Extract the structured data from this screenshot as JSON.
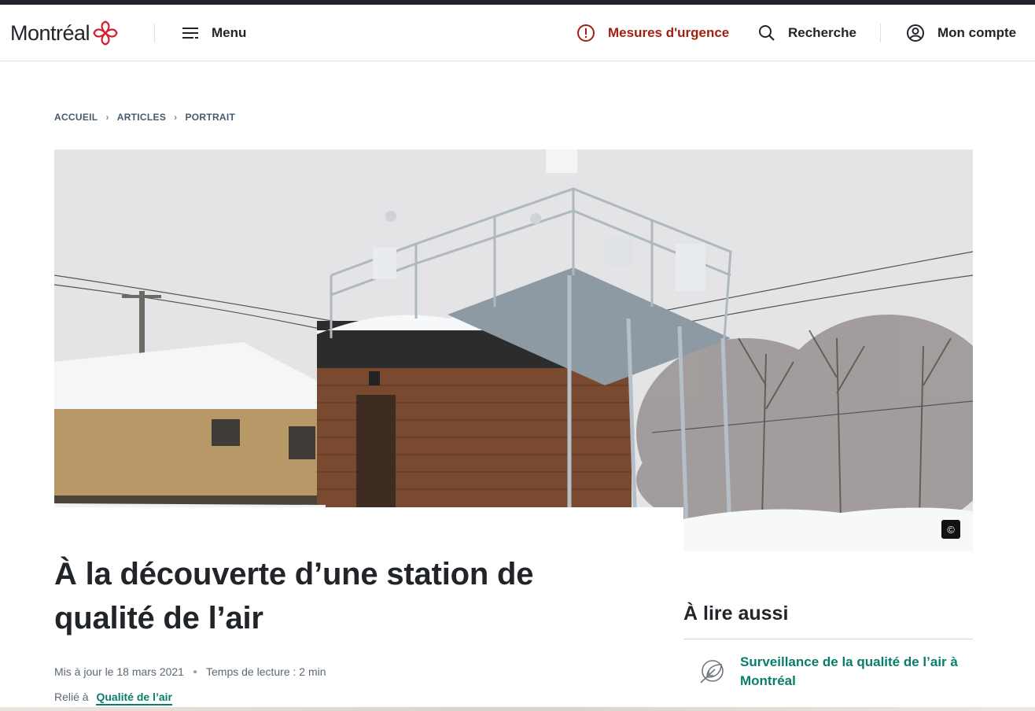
{
  "header": {
    "logo_text": "Montréal",
    "menu_label": "Menu",
    "urgence_label": "Mesures d'urgence",
    "search_label": "Recherche",
    "account_label": "Mon compte"
  },
  "breadcrumb": [
    "ACCUEIL",
    "ARTICLES",
    "PORTRAIT"
  ],
  "hero": {
    "copyright_symbol": "©"
  },
  "article": {
    "title": "À la découverte d’une station de qualité de l’air",
    "updated": "Mis à jour le 18 mars 2021",
    "reading_time": "Temps de lecture : 2 min",
    "related_prefix": "Relié à",
    "related_link": "Qualité de l’air"
  },
  "aside": {
    "title": "À lire aussi",
    "items": [
      {
        "label": "Surveillance de la qualité de l’air à Montréal",
        "icon": "leaf-icon"
      }
    ]
  },
  "colors": {
    "urgence": "#a2200f",
    "link": "#097d6c",
    "logo_red": "#d41f2a"
  }
}
